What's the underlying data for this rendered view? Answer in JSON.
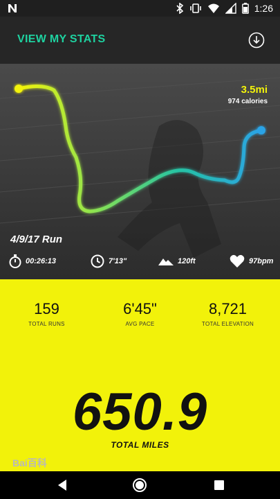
{
  "status_bar": {
    "time": "1:26",
    "icons": [
      "notification-n-icon",
      "bluetooth-icon",
      "vibrate-icon",
      "wifi-icon",
      "cell-signal-icon",
      "battery-icon"
    ]
  },
  "header": {
    "title": "VIEW MY STATS",
    "download_icon": "download-circle-icon",
    "accent_color": "#1ed2a0"
  },
  "run": {
    "distance": "3.5mi",
    "calories": "974 calories",
    "date_label": "4/9/17 Run",
    "duration": "00:26:13",
    "pace": "7'13\"",
    "elevation": "120ft",
    "heart_rate": "97bpm",
    "route_colors": [
      "#f3f30a",
      "#7fe05a",
      "#27c3a2",
      "#2aa3e6"
    ]
  },
  "summary": {
    "total_runs": {
      "value": "159",
      "label": "TOTAL RUNS"
    },
    "avg_pace": {
      "value": "6'45\"",
      "label": "AVG PACE"
    },
    "total_elevation": {
      "value": "8,721",
      "label": "TOTAL ELEVATION"
    },
    "total_miles": {
      "value": "650.9",
      "label": "TOTAL MILES"
    },
    "panel_color": "#f2f20a"
  },
  "watermark": "Bai百科",
  "nav": {
    "back": "back-triangle-icon",
    "home": "home-circle-icon",
    "recents": "recents-square-icon"
  }
}
